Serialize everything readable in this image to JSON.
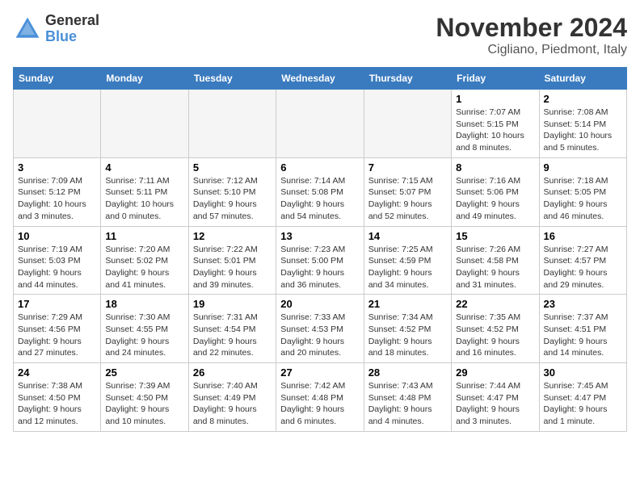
{
  "header": {
    "logo_general": "General",
    "logo_blue": "Blue",
    "month": "November 2024",
    "location": "Cigliano, Piedmont, Italy"
  },
  "weekdays": [
    "Sunday",
    "Monday",
    "Tuesday",
    "Wednesday",
    "Thursday",
    "Friday",
    "Saturday"
  ],
  "weeks": [
    [
      {
        "day": "",
        "info": "",
        "empty": true
      },
      {
        "day": "",
        "info": "",
        "empty": true
      },
      {
        "day": "",
        "info": "",
        "empty": true
      },
      {
        "day": "",
        "info": "",
        "empty": true
      },
      {
        "day": "",
        "info": "",
        "empty": true
      },
      {
        "day": "1",
        "info": "Sunrise: 7:07 AM\nSunset: 5:15 PM\nDaylight: 10 hours\nand 8 minutes."
      },
      {
        "day": "2",
        "info": "Sunrise: 7:08 AM\nSunset: 5:14 PM\nDaylight: 10 hours\nand 5 minutes."
      }
    ],
    [
      {
        "day": "3",
        "info": "Sunrise: 7:09 AM\nSunset: 5:12 PM\nDaylight: 10 hours\nand 3 minutes."
      },
      {
        "day": "4",
        "info": "Sunrise: 7:11 AM\nSunset: 5:11 PM\nDaylight: 10 hours\nand 0 minutes."
      },
      {
        "day": "5",
        "info": "Sunrise: 7:12 AM\nSunset: 5:10 PM\nDaylight: 9 hours\nand 57 minutes."
      },
      {
        "day": "6",
        "info": "Sunrise: 7:14 AM\nSunset: 5:08 PM\nDaylight: 9 hours\nand 54 minutes."
      },
      {
        "day": "7",
        "info": "Sunrise: 7:15 AM\nSunset: 5:07 PM\nDaylight: 9 hours\nand 52 minutes."
      },
      {
        "day": "8",
        "info": "Sunrise: 7:16 AM\nSunset: 5:06 PM\nDaylight: 9 hours\nand 49 minutes."
      },
      {
        "day": "9",
        "info": "Sunrise: 7:18 AM\nSunset: 5:05 PM\nDaylight: 9 hours\nand 46 minutes."
      }
    ],
    [
      {
        "day": "10",
        "info": "Sunrise: 7:19 AM\nSunset: 5:03 PM\nDaylight: 9 hours\nand 44 minutes."
      },
      {
        "day": "11",
        "info": "Sunrise: 7:20 AM\nSunset: 5:02 PM\nDaylight: 9 hours\nand 41 minutes."
      },
      {
        "day": "12",
        "info": "Sunrise: 7:22 AM\nSunset: 5:01 PM\nDaylight: 9 hours\nand 39 minutes."
      },
      {
        "day": "13",
        "info": "Sunrise: 7:23 AM\nSunset: 5:00 PM\nDaylight: 9 hours\nand 36 minutes."
      },
      {
        "day": "14",
        "info": "Sunrise: 7:25 AM\nSunset: 4:59 PM\nDaylight: 9 hours\nand 34 minutes."
      },
      {
        "day": "15",
        "info": "Sunrise: 7:26 AM\nSunset: 4:58 PM\nDaylight: 9 hours\nand 31 minutes."
      },
      {
        "day": "16",
        "info": "Sunrise: 7:27 AM\nSunset: 4:57 PM\nDaylight: 9 hours\nand 29 minutes."
      }
    ],
    [
      {
        "day": "17",
        "info": "Sunrise: 7:29 AM\nSunset: 4:56 PM\nDaylight: 9 hours\nand 27 minutes."
      },
      {
        "day": "18",
        "info": "Sunrise: 7:30 AM\nSunset: 4:55 PM\nDaylight: 9 hours\nand 24 minutes."
      },
      {
        "day": "19",
        "info": "Sunrise: 7:31 AM\nSunset: 4:54 PM\nDaylight: 9 hours\nand 22 minutes."
      },
      {
        "day": "20",
        "info": "Sunrise: 7:33 AM\nSunset: 4:53 PM\nDaylight: 9 hours\nand 20 minutes."
      },
      {
        "day": "21",
        "info": "Sunrise: 7:34 AM\nSunset: 4:52 PM\nDaylight: 9 hours\nand 18 minutes."
      },
      {
        "day": "22",
        "info": "Sunrise: 7:35 AM\nSunset: 4:52 PM\nDaylight: 9 hours\nand 16 minutes."
      },
      {
        "day": "23",
        "info": "Sunrise: 7:37 AM\nSunset: 4:51 PM\nDaylight: 9 hours\nand 14 minutes."
      }
    ],
    [
      {
        "day": "24",
        "info": "Sunrise: 7:38 AM\nSunset: 4:50 PM\nDaylight: 9 hours\nand 12 minutes."
      },
      {
        "day": "25",
        "info": "Sunrise: 7:39 AM\nSunset: 4:50 PM\nDaylight: 9 hours\nand 10 minutes."
      },
      {
        "day": "26",
        "info": "Sunrise: 7:40 AM\nSunset: 4:49 PM\nDaylight: 9 hours\nand 8 minutes."
      },
      {
        "day": "27",
        "info": "Sunrise: 7:42 AM\nSunset: 4:48 PM\nDaylight: 9 hours\nand 6 minutes."
      },
      {
        "day": "28",
        "info": "Sunrise: 7:43 AM\nSunset: 4:48 PM\nDaylight: 9 hours\nand 4 minutes."
      },
      {
        "day": "29",
        "info": "Sunrise: 7:44 AM\nSunset: 4:47 PM\nDaylight: 9 hours\nand 3 minutes."
      },
      {
        "day": "30",
        "info": "Sunrise: 7:45 AM\nSunset: 4:47 PM\nDaylight: 9 hours\nand 1 minute."
      }
    ]
  ]
}
